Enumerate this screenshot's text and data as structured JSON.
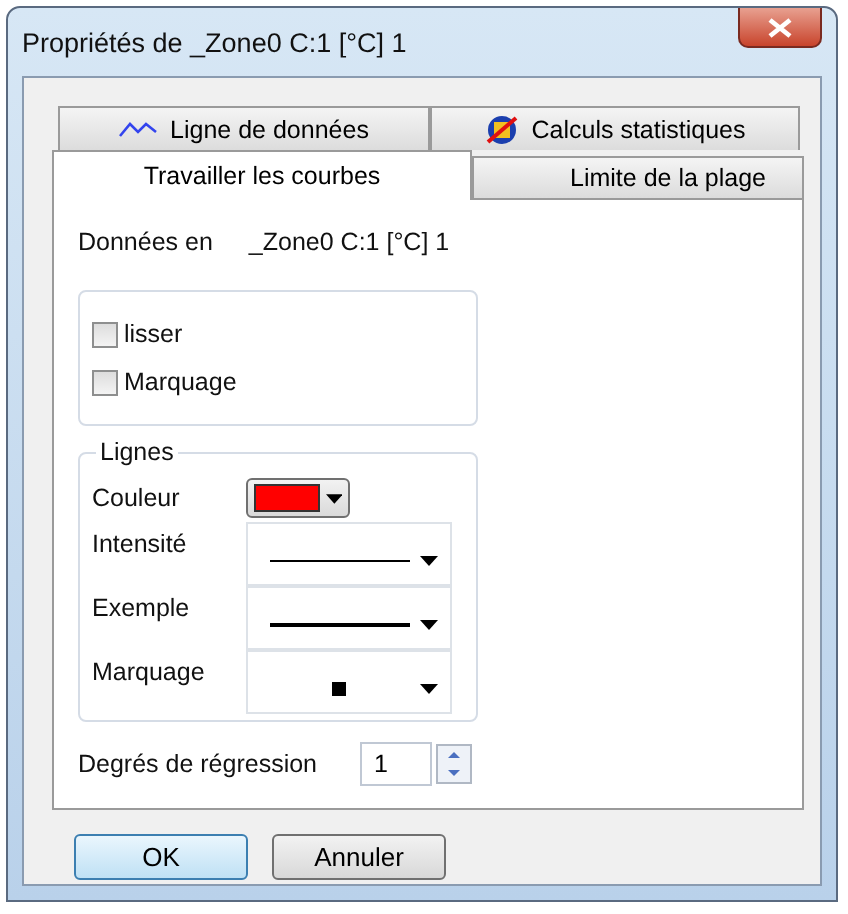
{
  "window": {
    "title": "Propriétés de _Zone0 C:1 [°C] 1"
  },
  "tab_rows": [
    {
      "tabs": [
        {
          "label": "Ligne de données",
          "kind": "line",
          "selected": false
        },
        {
          "label": "Calculs statistiques",
          "kind": "stats",
          "selected": false
        }
      ]
    },
    {
      "tabs": [
        {
          "label": "Travailler les courbes",
          "kind": "plain",
          "selected": true
        },
        {
          "label": "Limite de la plage",
          "kind": "plain",
          "selected": false
        }
      ]
    }
  ],
  "data_source": {
    "label": "Données en",
    "value": "_Zone0 C:1 [°C] 1"
  },
  "options": [
    {
      "label": "lisser",
      "checked": false
    },
    {
      "label": "Marquage",
      "checked": false
    }
  ],
  "lines_group": {
    "title": "Lignes",
    "color": {
      "label": "Couleur",
      "color": "#ff0000"
    },
    "fields": [
      {
        "label": "Intensité",
        "kind": "thin-line"
      },
      {
        "label": "Exemple",
        "kind": "thick-line"
      },
      {
        "label": "Marquage",
        "kind": "square-marker"
      }
    ]
  },
  "regression": {
    "label": "Degrés de régression",
    "value": "1"
  },
  "buttons": [
    {
      "label": "OK",
      "default": true
    },
    {
      "label": "Annuler",
      "default": false
    }
  ]
}
